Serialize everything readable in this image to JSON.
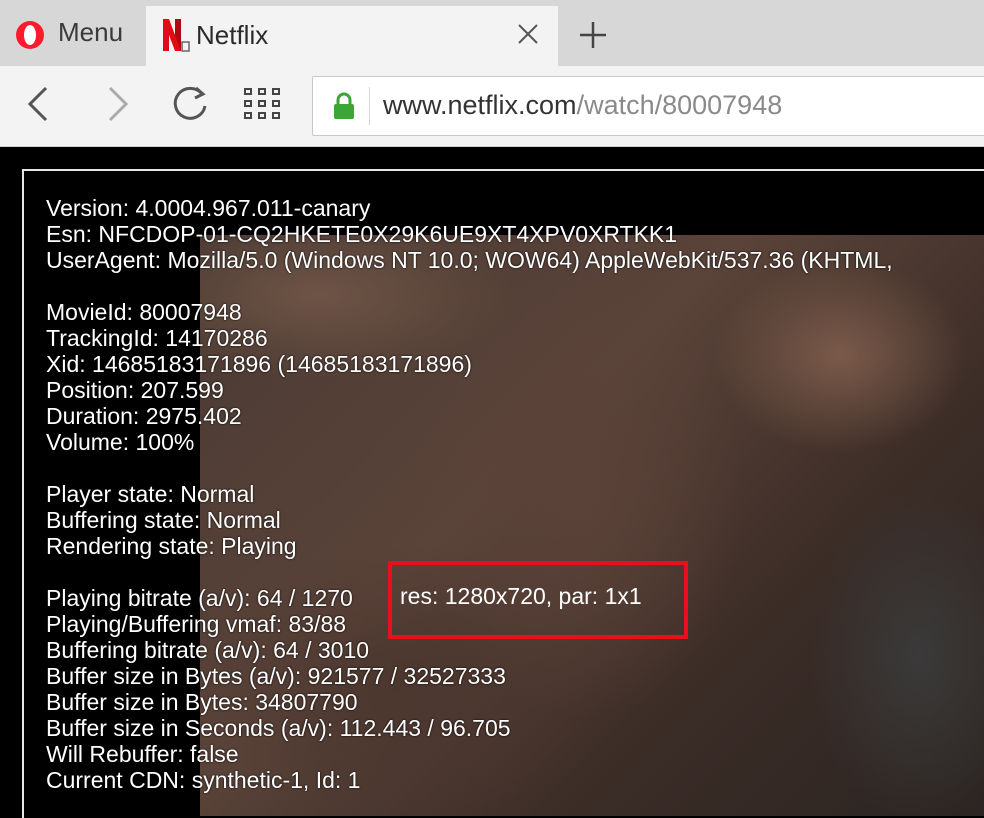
{
  "tabs": {
    "menu_label": "Menu",
    "active_title": "Netflix"
  },
  "toolbar": {
    "url_host": "www.netflix.com",
    "url_path": "/watch/80007948"
  },
  "debug": {
    "version": "Version: 4.0004.967.011-canary",
    "esn": "Esn: NFCDOP-01-CQ2HKETE0X29K6UE9XT4XPV0XRTKK1",
    "user_agent": "UserAgent: Mozilla/5.0 (Windows NT 10.0; WOW64) AppleWebKit/537.36 (KHTML,",
    "movie_id": "MovieId: 80007948",
    "tracking_id": "TrackingId: 14170286",
    "xid": "Xid: 14685183171896 (14685183171896)",
    "position": "Position: 207.599",
    "duration": "Duration: 2975.402",
    "volume": "Volume: 100%",
    "player_state": "Player state: Normal",
    "buffering_state": "Buffering state: Normal",
    "rendering_state": "Rendering state: Playing",
    "playing_bitrate": "Playing bitrate (a/v): 64 / 1270",
    "resolution": "res: 1280x720, par: 1x1",
    "vmaf": "Playing/Buffering vmaf: 83/88",
    "buffering_bitrate": "Buffering bitrate (a/v): 64 / 3010",
    "buffer_bytes_av": "Buffer size in Bytes (a/v): 921577 / 32527333",
    "buffer_bytes": "Buffer size in Bytes: 34807790",
    "buffer_seconds": "Buffer size in Seconds (a/v): 112.443 / 96.705",
    "will_rebuffer": "Will Rebuffer: false",
    "current_cdn": "Current CDN: synthetic-1, Id: 1"
  },
  "colors": {
    "highlight": "#e8101b",
    "netflix_red": "#e50914",
    "opera_red": "#ff1b2d",
    "lock_green": "#3aa635"
  },
  "icons": [
    "opera-logo-icon",
    "netflix-logo-icon",
    "close-icon",
    "plus-icon",
    "back-arrow-icon",
    "forward-arrow-icon",
    "reload-icon",
    "speed-dial-grid-icon",
    "lock-icon"
  ]
}
